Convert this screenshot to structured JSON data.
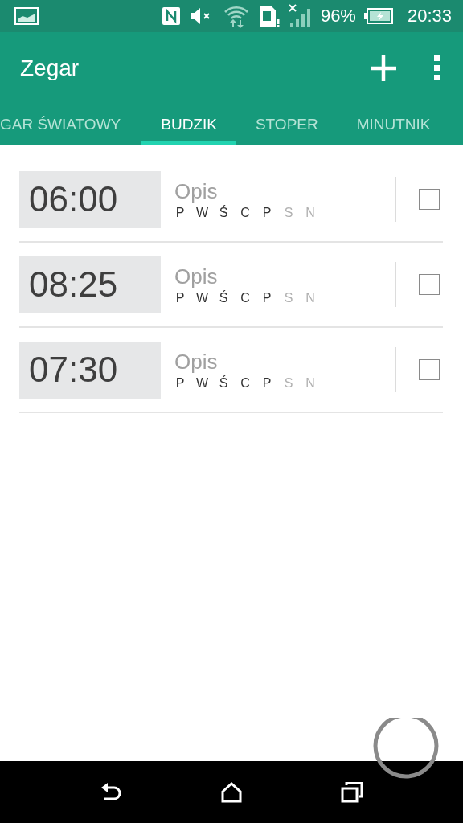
{
  "status_bar": {
    "battery": "96%",
    "time": "20:33"
  },
  "app_bar": {
    "title": "Zegar"
  },
  "tabs": [
    {
      "label": "GAR ŚWIATOWY",
      "selected": false
    },
    {
      "label": "BUDZIK",
      "selected": true
    },
    {
      "label": "STOPER",
      "selected": false
    },
    {
      "label": "MINUTNIK",
      "selected": false
    }
  ],
  "alarms": [
    {
      "time": "06:00",
      "label": "Opis",
      "checked": false,
      "days": [
        {
          "letter": "P",
          "on": true
        },
        {
          "letter": "W",
          "on": true
        },
        {
          "letter": "Ś",
          "on": true
        },
        {
          "letter": "C",
          "on": true
        },
        {
          "letter": "P",
          "on": true
        },
        {
          "letter": "S",
          "on": false
        },
        {
          "letter": "N",
          "on": false
        }
      ]
    },
    {
      "time": "08:25",
      "label": "Opis",
      "checked": false,
      "days": [
        {
          "letter": "P",
          "on": true
        },
        {
          "letter": "W",
          "on": true
        },
        {
          "letter": "Ś",
          "on": true
        },
        {
          "letter": "C",
          "on": true
        },
        {
          "letter": "P",
          "on": true
        },
        {
          "letter": "S",
          "on": false
        },
        {
          "letter": "N",
          "on": false
        }
      ]
    },
    {
      "time": "07:30",
      "label": "Opis",
      "checked": false,
      "days": [
        {
          "letter": "P",
          "on": true
        },
        {
          "letter": "W",
          "on": true
        },
        {
          "letter": "Ś",
          "on": true
        },
        {
          "letter": "C",
          "on": true
        },
        {
          "letter": "P",
          "on": true
        },
        {
          "letter": "S",
          "on": false
        },
        {
          "letter": "N",
          "on": false
        }
      ]
    }
  ]
}
